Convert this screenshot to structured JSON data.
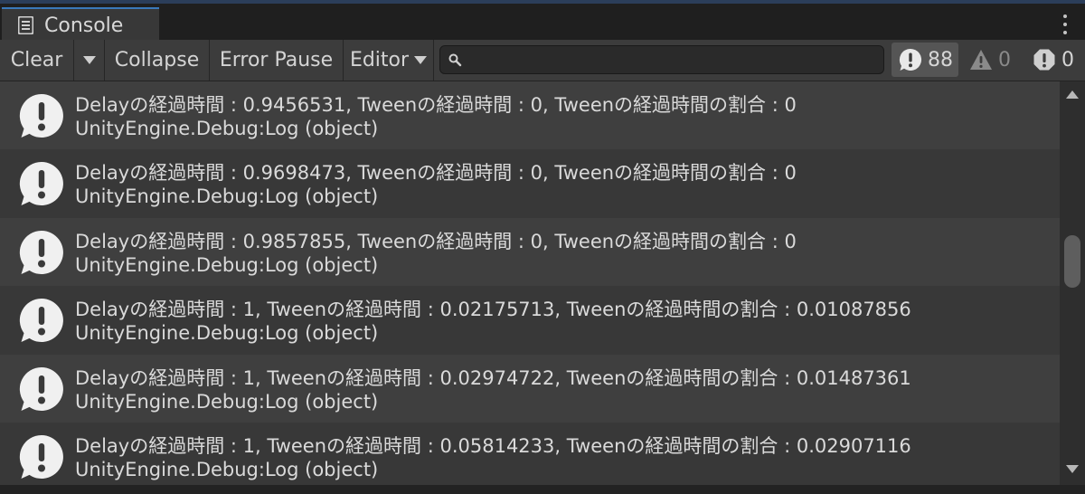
{
  "tab": {
    "label": "Console",
    "icon": "console-list-icon"
  },
  "toolbar": {
    "clear_label": "Clear",
    "collapse_label": "Collapse",
    "error_pause_label": "Error Pause",
    "editor_label": "Editor",
    "search_value": "",
    "info_count": "88",
    "warning_count": "0",
    "error_count": "0"
  },
  "colors": {
    "tab_accent": "#3a79bb",
    "panel_bg": "#383838",
    "row_alt_bg": "#3f3f3f",
    "text": "#dadada"
  },
  "logs": [
    {
      "message": "Delayの経過時間 : 0.9456531, Tweenの経過時間 : 0, Tweenの経過時間の割合 : 0",
      "stack": "UnityEngine.Debug:Log (object)"
    },
    {
      "message": "Delayの経過時間 : 0.9698473, Tweenの経過時間 : 0, Tweenの経過時間の割合 : 0",
      "stack": "UnityEngine.Debug:Log (object)"
    },
    {
      "message": "Delayの経過時間 : 0.9857855, Tweenの経過時間 : 0, Tweenの経過時間の割合 : 0",
      "stack": "UnityEngine.Debug:Log (object)"
    },
    {
      "message": "Delayの経過時間 : 1, Tweenの経過時間 : 0.02175713, Tweenの経過時間の割合 : 0.01087856",
      "stack": "UnityEngine.Debug:Log (object)"
    },
    {
      "message": "Delayの経過時間 : 1, Tweenの経過時間 : 0.02974722, Tweenの経過時間の割合 : 0.01487361",
      "stack": "UnityEngine.Debug:Log (object)"
    },
    {
      "message": "Delayの経過時間 : 1, Tweenの経過時間 : 0.05814233, Tweenの経過時間の割合 : 0.02907116",
      "stack": "UnityEngine.Debug:Log (object)"
    }
  ]
}
